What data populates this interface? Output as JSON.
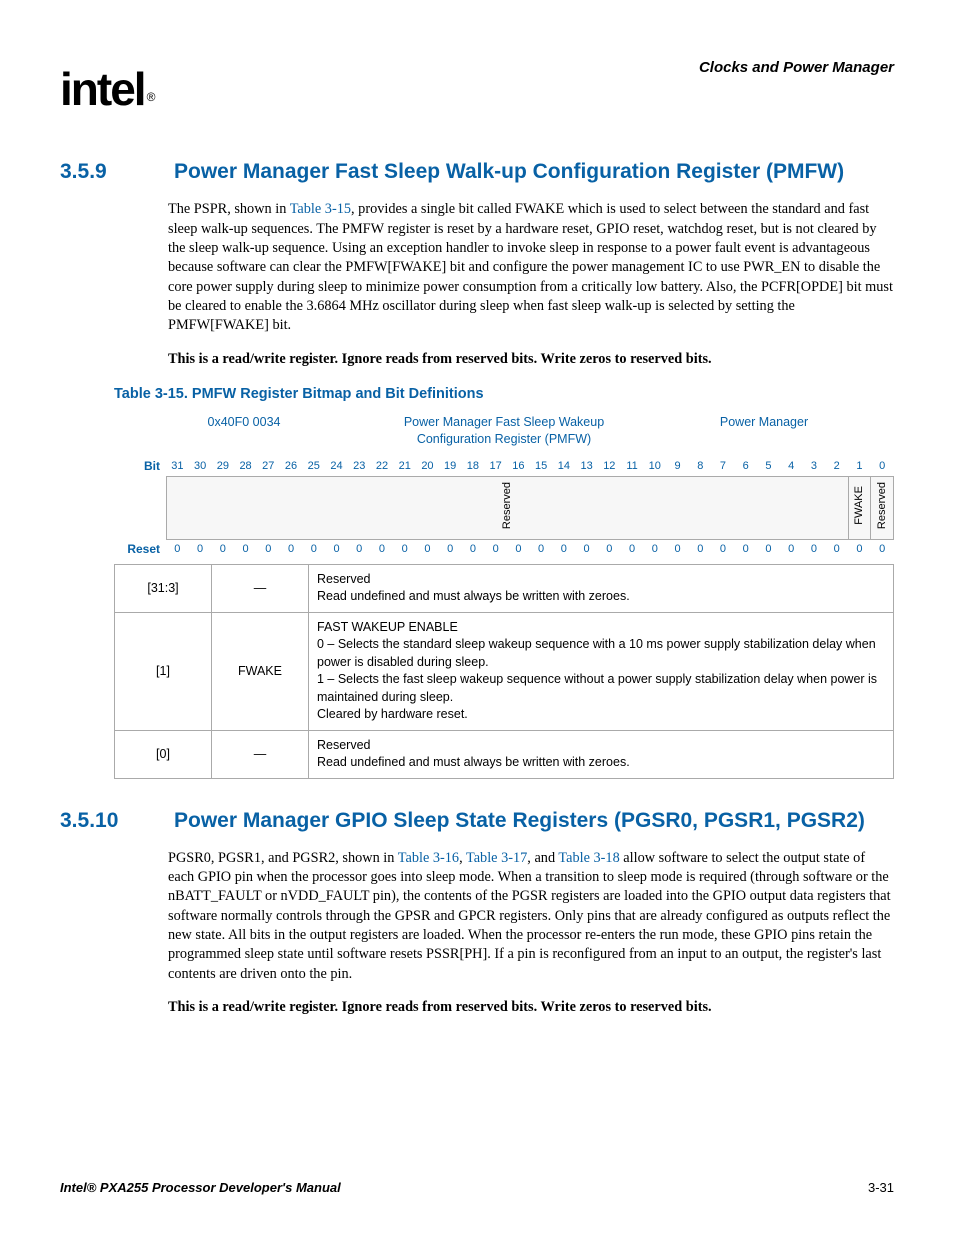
{
  "chapter_header": "Clocks and Power Manager",
  "logo_text": "intel",
  "section_a": {
    "num": "3.5.9",
    "title": "Power Manager Fast Sleep Walk-up Configuration Register (PMFW)",
    "para_pre": "The PSPR, shown in ",
    "para_link": "Table 3-15",
    "para_post": ", provides a single bit called FWAKE which is used to select between the standard and fast sleep walk-up sequences. The PMFW register is reset by a hardware reset, GPIO reset, watchdog reset, but is not cleared by the sleep walk-up sequence. Using an exception handler to invoke sleep in response to a power fault event is advantageous because software can clear the PMFW[FWAKE] bit and configure the power management IC to use PWR_EN to disable the core power supply during sleep to minimize power consumption from a critically low battery. Also, the PCFR[OPDE] bit must be cleared to enable the 3.6864 MHz oscillator during sleep when fast sleep walk-up is selected by setting the PMFW[FWAKE] bit.",
    "note": "This is a read/write register. Ignore reads from reserved bits. Write zeros to reserved bits."
  },
  "table_caption": "Table 3-15. PMFW Register Bitmap and Bit Definitions",
  "register": {
    "addr": "0x40F0 0034",
    "name": "Power Manager Fast Sleep Wakeup Configuration Register (PMFW)",
    "block": "Power Manager",
    "row_bit": "Bit",
    "row_reset": "Reset",
    "bits": [
      "31",
      "30",
      "29",
      "28",
      "27",
      "26",
      "25",
      "24",
      "23",
      "22",
      "21",
      "20",
      "19",
      "18",
      "17",
      "16",
      "15",
      "14",
      "13",
      "12",
      "11",
      "10",
      "9",
      "8",
      "7",
      "6",
      "5",
      "4",
      "3",
      "2",
      "1",
      "0"
    ],
    "field_reserved": "Reserved",
    "field_fwake": "FWAKE",
    "resets": [
      "0",
      "0",
      "0",
      "0",
      "0",
      "0",
      "0",
      "0",
      "0",
      "0",
      "0",
      "0",
      "0",
      "0",
      "0",
      "0",
      "0",
      "0",
      "0",
      "0",
      "0",
      "0",
      "0",
      "0",
      "0",
      "0",
      "0",
      "0",
      "0",
      "0",
      "0",
      "0"
    ]
  },
  "desc_rows": [
    {
      "bits": "[31:3]",
      "name": "—",
      "l1": "Reserved",
      "l2": "Read undefined and must always be written with zeroes."
    },
    {
      "bits": "[1]",
      "name": "FWAKE",
      "t": "FAST WAKEUP ENABLE",
      "o0": "0 –  Selects the standard sleep wakeup sequence with a 10 ms power supply stabilization delay when power is disabled during sleep.",
      "o1": "1 –  Selects the fast sleep wakeup sequence without a power supply stabilization delay when power is maintained during sleep.",
      "c": "Cleared by hardware reset."
    },
    {
      "bits": "[0]",
      "name": "—",
      "l1": "Reserved",
      "l2": "Read undefined and must always be written with zeroes."
    }
  ],
  "section_b": {
    "num": "3.5.10",
    "title": "Power Manager GPIO Sleep State Registers (PGSR0, PGSR1, PGSR2)",
    "p_pre": "PGSR0, PGSR1, and PGSR2, shown in ",
    "p_l1": "Table 3-16",
    "p_m1": ", ",
    "p_l2": "Table 3-17",
    "p_m2": ", and ",
    "p_l3": "Table 3-18",
    "p_post": " allow software to select the output state of each GPIO pin when the processor goes into sleep mode. When a transition to sleep mode is required (through software or the nBATT_FAULT or nVDD_FAULT pin), the contents of the PGSR registers are loaded into the GPIO output data registers that software normally controls through the GPSR and GPCR registers. Only pins that are already configured as outputs reflect the new state. All bits in the output registers are loaded. When the processor re-enters the run mode, these GPIO pins retain the programmed sleep state until software resets PSSR[PH]. If a pin is reconfigured from an input to an output, the register's last contents are driven onto the pin.",
    "note": "This is a read/write register. Ignore reads from reserved bits. Write zeros to reserved bits."
  },
  "footer": {
    "title": "Intel® PXA255 Processor Developer's Manual",
    "page": "3-31"
  }
}
